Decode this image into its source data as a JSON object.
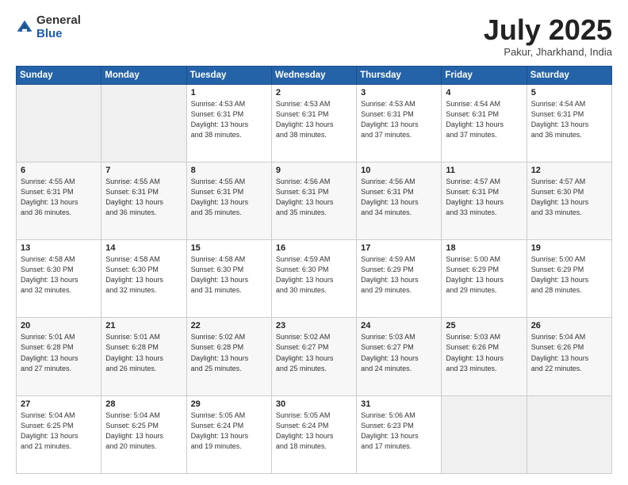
{
  "header": {
    "logo_general": "General",
    "logo_blue": "Blue",
    "month_title": "July 2025",
    "location": "Pakur, Jharkhand, India"
  },
  "weekdays": [
    "Sunday",
    "Monday",
    "Tuesday",
    "Wednesday",
    "Thursday",
    "Friday",
    "Saturday"
  ],
  "weeks": [
    [
      {
        "day": "",
        "info": ""
      },
      {
        "day": "",
        "info": ""
      },
      {
        "day": "1",
        "info": "Sunrise: 4:53 AM\nSunset: 6:31 PM\nDaylight: 13 hours\nand 38 minutes."
      },
      {
        "day": "2",
        "info": "Sunrise: 4:53 AM\nSunset: 6:31 PM\nDaylight: 13 hours\nand 38 minutes."
      },
      {
        "day": "3",
        "info": "Sunrise: 4:53 AM\nSunset: 6:31 PM\nDaylight: 13 hours\nand 37 minutes."
      },
      {
        "day": "4",
        "info": "Sunrise: 4:54 AM\nSunset: 6:31 PM\nDaylight: 13 hours\nand 37 minutes."
      },
      {
        "day": "5",
        "info": "Sunrise: 4:54 AM\nSunset: 6:31 PM\nDaylight: 13 hours\nand 36 minutes."
      }
    ],
    [
      {
        "day": "6",
        "info": "Sunrise: 4:55 AM\nSunset: 6:31 PM\nDaylight: 13 hours\nand 36 minutes."
      },
      {
        "day": "7",
        "info": "Sunrise: 4:55 AM\nSunset: 6:31 PM\nDaylight: 13 hours\nand 36 minutes."
      },
      {
        "day": "8",
        "info": "Sunrise: 4:55 AM\nSunset: 6:31 PM\nDaylight: 13 hours\nand 35 minutes."
      },
      {
        "day": "9",
        "info": "Sunrise: 4:56 AM\nSunset: 6:31 PM\nDaylight: 13 hours\nand 35 minutes."
      },
      {
        "day": "10",
        "info": "Sunrise: 4:56 AM\nSunset: 6:31 PM\nDaylight: 13 hours\nand 34 minutes."
      },
      {
        "day": "11",
        "info": "Sunrise: 4:57 AM\nSunset: 6:31 PM\nDaylight: 13 hours\nand 33 minutes."
      },
      {
        "day": "12",
        "info": "Sunrise: 4:57 AM\nSunset: 6:30 PM\nDaylight: 13 hours\nand 33 minutes."
      }
    ],
    [
      {
        "day": "13",
        "info": "Sunrise: 4:58 AM\nSunset: 6:30 PM\nDaylight: 13 hours\nand 32 minutes."
      },
      {
        "day": "14",
        "info": "Sunrise: 4:58 AM\nSunset: 6:30 PM\nDaylight: 13 hours\nand 32 minutes."
      },
      {
        "day": "15",
        "info": "Sunrise: 4:58 AM\nSunset: 6:30 PM\nDaylight: 13 hours\nand 31 minutes."
      },
      {
        "day": "16",
        "info": "Sunrise: 4:59 AM\nSunset: 6:30 PM\nDaylight: 13 hours\nand 30 minutes."
      },
      {
        "day": "17",
        "info": "Sunrise: 4:59 AM\nSunset: 6:29 PM\nDaylight: 13 hours\nand 29 minutes."
      },
      {
        "day": "18",
        "info": "Sunrise: 5:00 AM\nSunset: 6:29 PM\nDaylight: 13 hours\nand 29 minutes."
      },
      {
        "day": "19",
        "info": "Sunrise: 5:00 AM\nSunset: 6:29 PM\nDaylight: 13 hours\nand 28 minutes."
      }
    ],
    [
      {
        "day": "20",
        "info": "Sunrise: 5:01 AM\nSunset: 6:28 PM\nDaylight: 13 hours\nand 27 minutes."
      },
      {
        "day": "21",
        "info": "Sunrise: 5:01 AM\nSunset: 6:28 PM\nDaylight: 13 hours\nand 26 minutes."
      },
      {
        "day": "22",
        "info": "Sunrise: 5:02 AM\nSunset: 6:28 PM\nDaylight: 13 hours\nand 25 minutes."
      },
      {
        "day": "23",
        "info": "Sunrise: 5:02 AM\nSunset: 6:27 PM\nDaylight: 13 hours\nand 25 minutes."
      },
      {
        "day": "24",
        "info": "Sunrise: 5:03 AM\nSunset: 6:27 PM\nDaylight: 13 hours\nand 24 minutes."
      },
      {
        "day": "25",
        "info": "Sunrise: 5:03 AM\nSunset: 6:26 PM\nDaylight: 13 hours\nand 23 minutes."
      },
      {
        "day": "26",
        "info": "Sunrise: 5:04 AM\nSunset: 6:26 PM\nDaylight: 13 hours\nand 22 minutes."
      }
    ],
    [
      {
        "day": "27",
        "info": "Sunrise: 5:04 AM\nSunset: 6:25 PM\nDaylight: 13 hours\nand 21 minutes."
      },
      {
        "day": "28",
        "info": "Sunrise: 5:04 AM\nSunset: 6:25 PM\nDaylight: 13 hours\nand 20 minutes."
      },
      {
        "day": "29",
        "info": "Sunrise: 5:05 AM\nSunset: 6:24 PM\nDaylight: 13 hours\nand 19 minutes."
      },
      {
        "day": "30",
        "info": "Sunrise: 5:05 AM\nSunset: 6:24 PM\nDaylight: 13 hours\nand 18 minutes."
      },
      {
        "day": "31",
        "info": "Sunrise: 5:06 AM\nSunset: 6:23 PM\nDaylight: 13 hours\nand 17 minutes."
      },
      {
        "day": "",
        "info": ""
      },
      {
        "day": "",
        "info": ""
      }
    ]
  ]
}
